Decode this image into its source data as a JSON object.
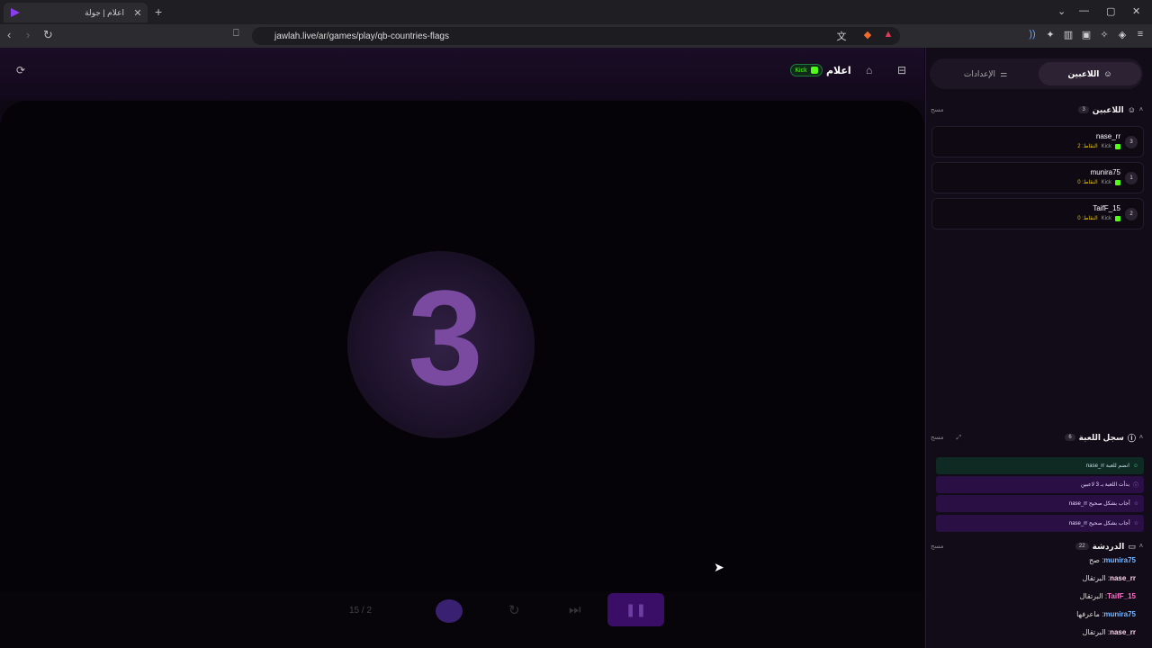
{
  "browser": {
    "tab_title": "اعلام | جولة",
    "url": "jawlah.live/ar/games/play/qb-countries-flags"
  },
  "game": {
    "title": "اعلام",
    "kick_label": "Kick",
    "countdown": "3",
    "progress": "15 / 2"
  },
  "sidebar": {
    "tab_players": "اللاعبين",
    "tab_settings": "الإعدادات",
    "players_header": "اللاعبين",
    "players_count": "3",
    "clear_label": "مسح",
    "players": [
      {
        "name": "nase_rr",
        "platform": "Kick",
        "points": "النقاط: 2",
        "rank": "3"
      },
      {
        "name": "munira75",
        "platform": "Kick",
        "points": "النقاط: 0",
        "rank": "1"
      },
      {
        "name": "TaifF_15",
        "platform": "Kick",
        "points": "النقاط: 0",
        "rank": "2"
      }
    ],
    "log_header": "سجل اللعبة",
    "log_count": "6",
    "log": [
      {
        "text": "nase_rr انضم للعبة",
        "type": "join"
      },
      {
        "text": "بدأت اللعبة بـ 3 لاعبين",
        "type": "start"
      },
      {
        "text": "nase_rr أجاب بشكل صحيح",
        "type": "correct"
      },
      {
        "text": "nase_rr أجاب بشكل صحيح",
        "type": "correct"
      }
    ],
    "chat_header": "الدردشة",
    "chat_count": "22",
    "chat": [
      {
        "user": "munira75",
        "msg": "صح"
      },
      {
        "user": "nase_rr",
        "msg": "البرتقال"
      },
      {
        "user": "TaifF_15",
        "msg": "البرتقال"
      },
      {
        "user": "munira75",
        "msg": "ماعرفها"
      },
      {
        "user": "nase_rr",
        "msg": "البرتقال"
      }
    ]
  }
}
